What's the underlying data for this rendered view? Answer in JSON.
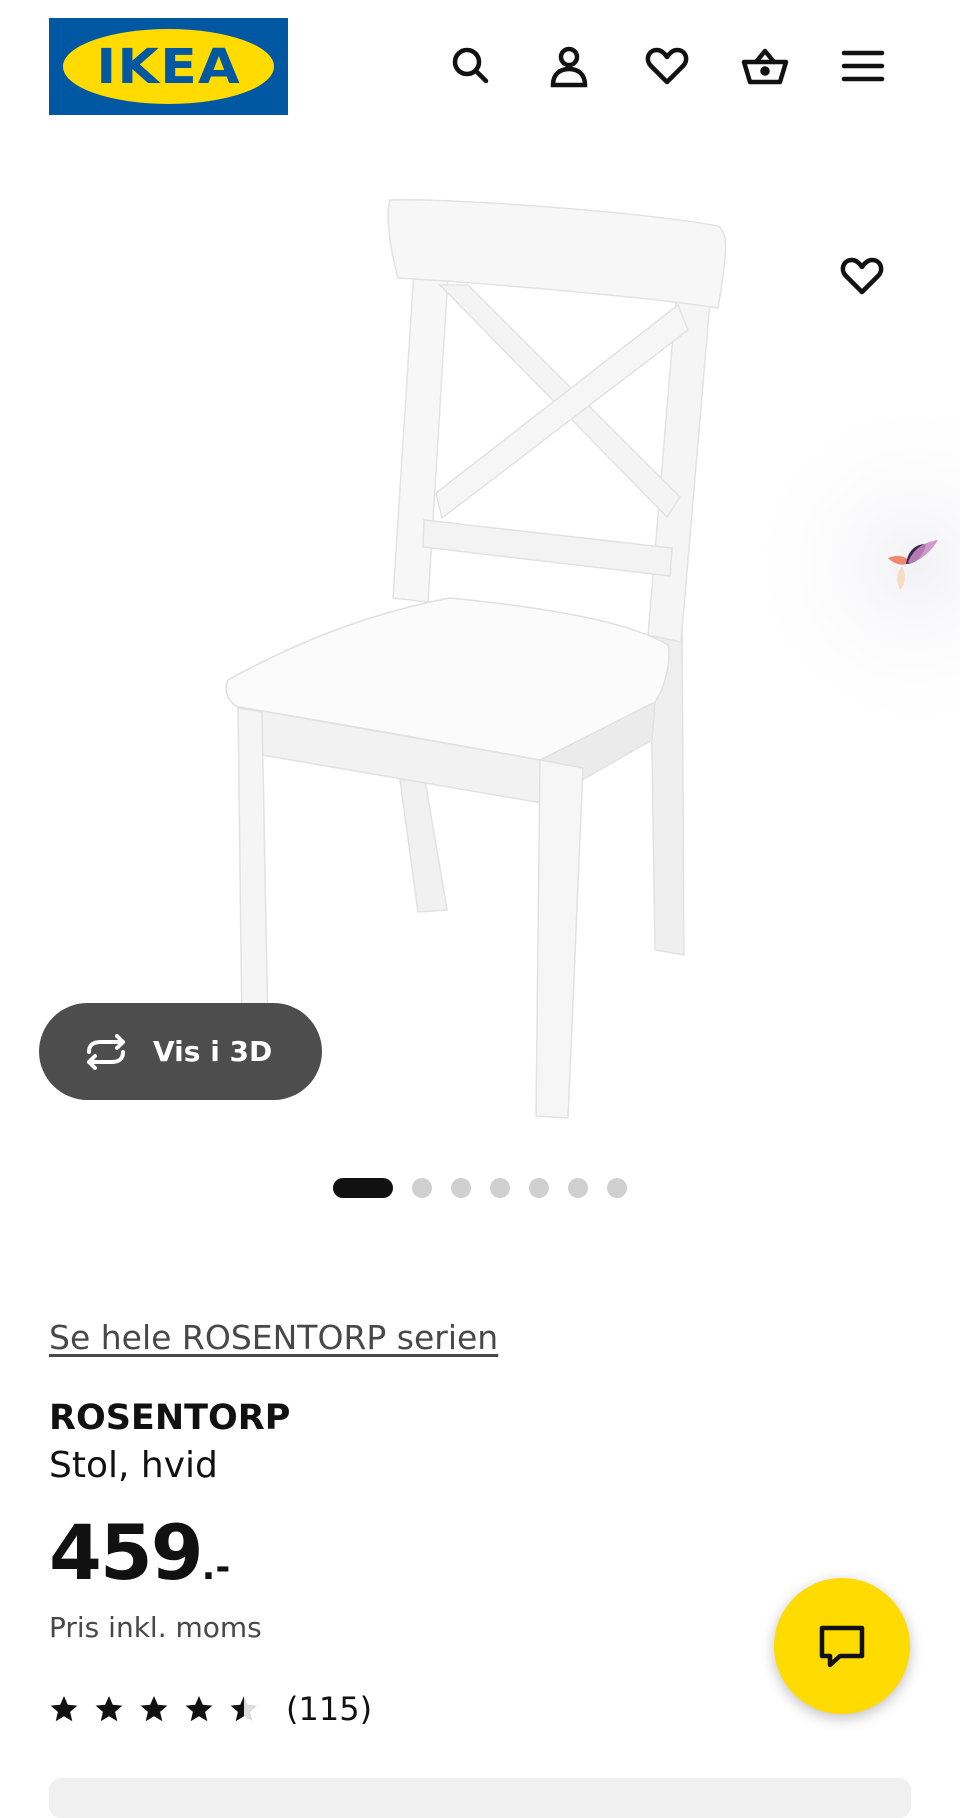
{
  "header": {
    "logo_text": "IKEA",
    "icons": [
      "search-icon",
      "user-icon",
      "heart-icon",
      "basket-icon",
      "menu-icon"
    ]
  },
  "gallery": {
    "view_3d_label": "Vis i 3D",
    "total_images": 7,
    "active_index": 0
  },
  "product": {
    "series_link": "Se hele ROSENTORP serien",
    "name": "ROSENTORP",
    "description": "Stol, hvid",
    "price_integer": "459",
    "price_suffix": ".-",
    "price_note": "Pris inkl. moms",
    "rating_value": 4.5,
    "rating_max": 5,
    "review_count": "(115)"
  },
  "colors": {
    "brand_blue": "#0058a3",
    "brand_yellow": "#ffdb00",
    "button_dark": "#4d4d4d"
  }
}
